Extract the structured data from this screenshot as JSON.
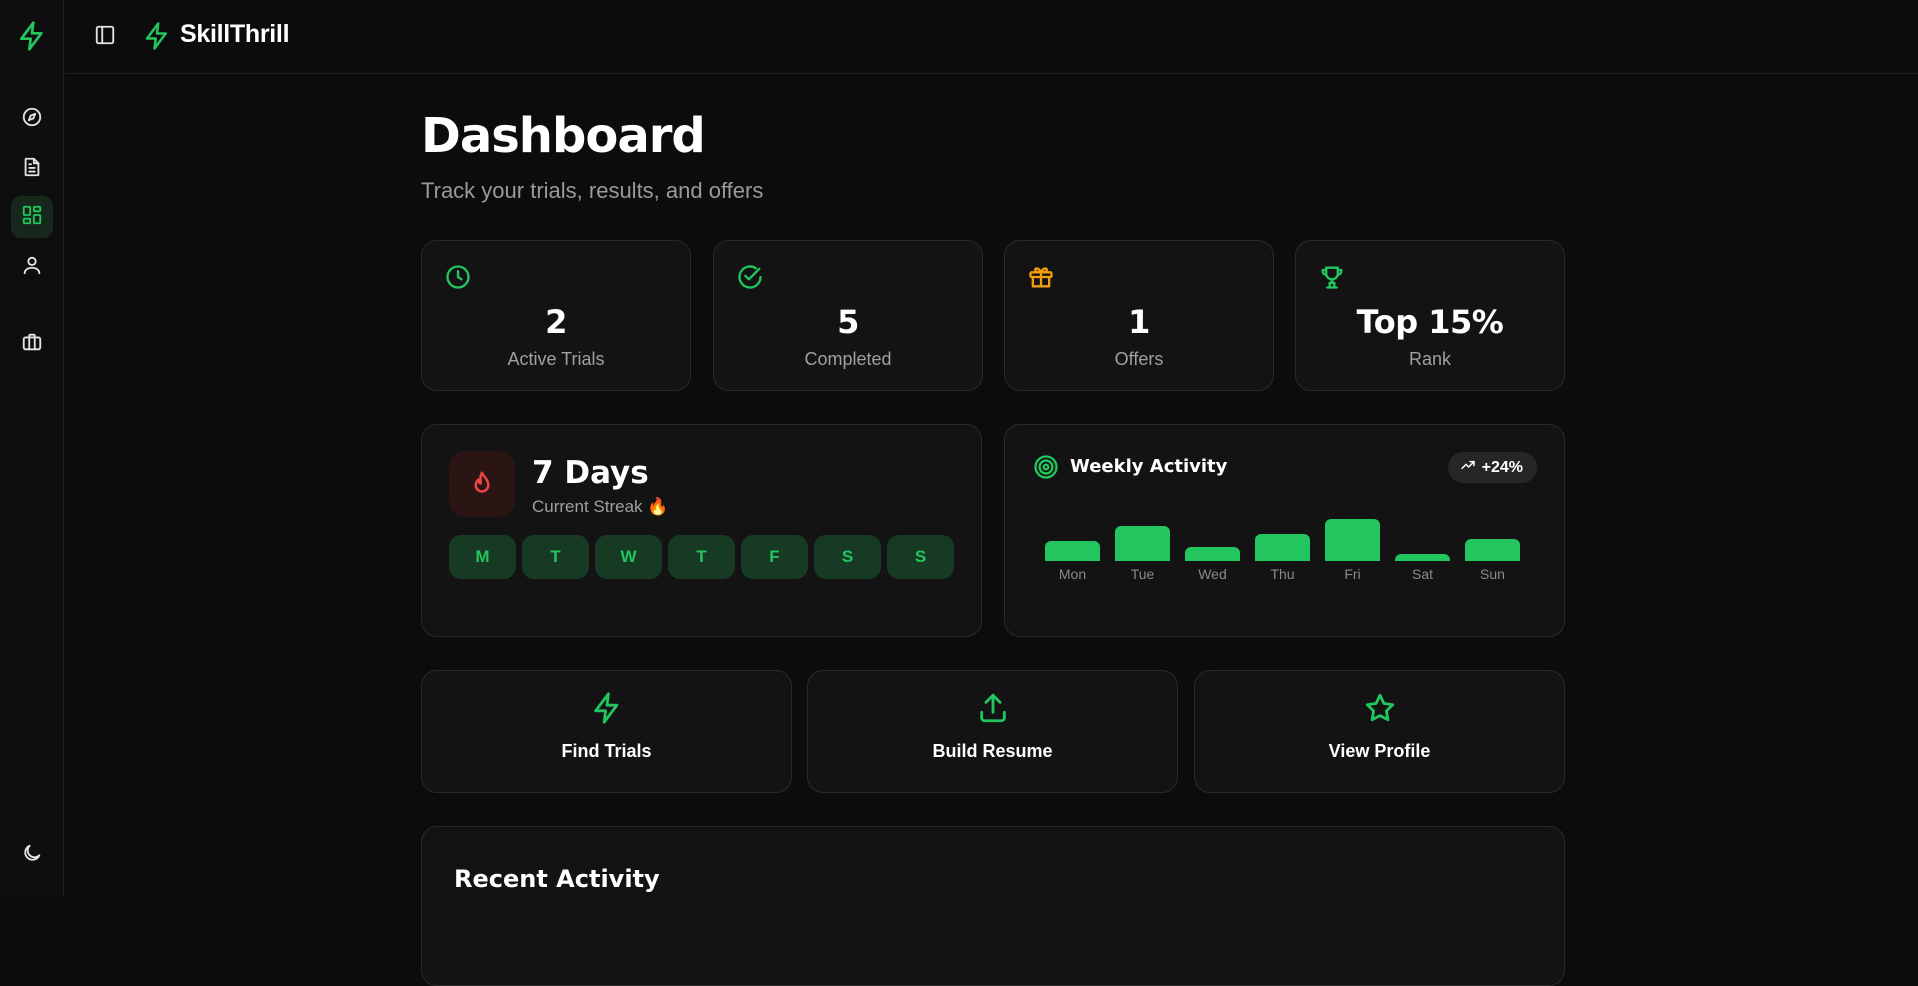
{
  "colors": {
    "accent": "#22c55e",
    "orange": "#f59e0b",
    "flame": "#ef4444",
    "background": "#0c0c0c",
    "card": "#131313"
  },
  "brand": {
    "name": "SkillThrill",
    "icon": "lightning-bolt-icon"
  },
  "sidebar": {
    "items": [
      {
        "icon": "compass-icon",
        "active": false
      },
      {
        "icon": "document-icon",
        "active": false
      },
      {
        "icon": "dashboard-grid-icon",
        "active": true
      },
      {
        "icon": "user-icon",
        "active": false
      },
      {
        "icon": "briefcase-icon",
        "active": false
      }
    ],
    "theme_toggle_icon": "moon-icon"
  },
  "page": {
    "title": "Dashboard",
    "subtitle": "Track your trials, results, and offers"
  },
  "stats": [
    {
      "icon": "clock-icon",
      "value": "2",
      "label": "Active Trials"
    },
    {
      "icon": "check-circle-icon",
      "value": "5",
      "label": "Completed"
    },
    {
      "icon": "gift-icon",
      "value": "1",
      "label": "Offers"
    },
    {
      "icon": "trophy-icon",
      "value": "Top 15%",
      "label": "Rank"
    }
  ],
  "streak": {
    "icon": "flame-icon",
    "title": "7 Days",
    "subtitle": "Current Streak 🔥",
    "days": [
      "M",
      "T",
      "W",
      "T",
      "F",
      "S",
      "S"
    ]
  },
  "activity": {
    "icon": "target-icon",
    "title": "Weekly Activity",
    "badge": "+24%",
    "badge_icon": "trending-up-icon",
    "chart_data": {
      "type": "bar",
      "categories": [
        "Mon",
        "Tue",
        "Wed",
        "Thu",
        "Fri",
        "Sat",
        "Sun"
      ],
      "values": [
        40,
        70,
        28,
        55,
        85,
        15,
        45
      ]
    }
  },
  "actions": [
    {
      "icon": "lightning-bolt-icon",
      "label": "Find Trials"
    },
    {
      "icon": "upload-icon",
      "label": "Build Resume"
    },
    {
      "icon": "star-icon",
      "label": "View Profile"
    }
  ],
  "recent": {
    "title": "Recent Activity"
  }
}
